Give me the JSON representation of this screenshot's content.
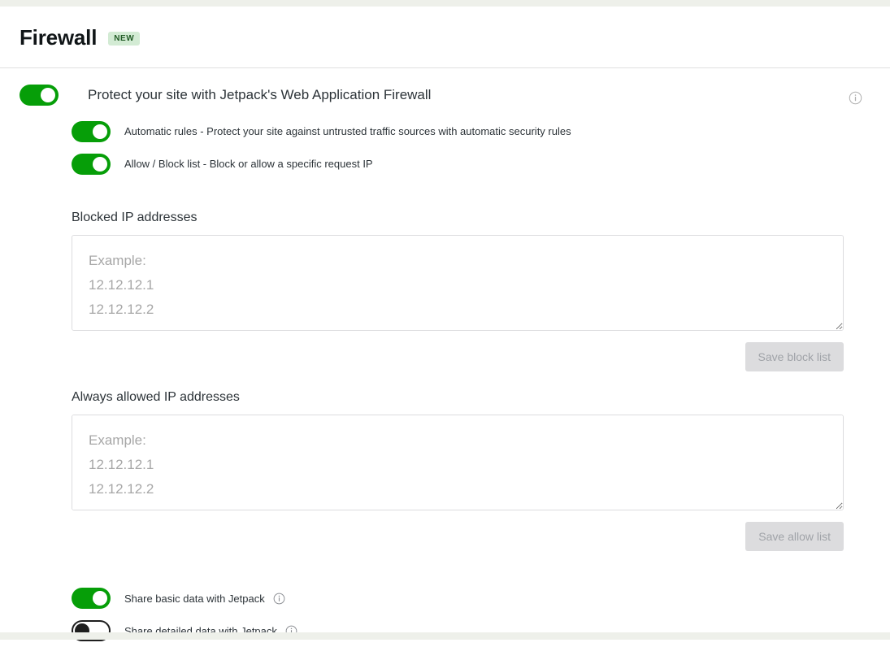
{
  "header": {
    "title": "Firewall",
    "badge": "NEW"
  },
  "master": {
    "label": "Protect your site with Jetpack's Web Application Firewall",
    "toggle_state": "on",
    "info_icon": "info-circle-icon"
  },
  "sub_toggles": [
    {
      "label": "Automatic rules - Protect your site against untrusted traffic sources with automatic security rules",
      "state": "on"
    },
    {
      "label": "Allow / Block list - Block or allow a specific request IP",
      "state": "on"
    }
  ],
  "blocked_section": {
    "label": "Blocked IP addresses",
    "value": "",
    "placeholder": "Example:\n12.12.12.1\n12.12.12.2",
    "save_label": "Save block list",
    "save_disabled": true
  },
  "allowed_section": {
    "label": "Always allowed IP addresses",
    "value": "",
    "placeholder": "Example:\n12.12.12.1\n12.12.12.2",
    "save_label": "Save allow list",
    "save_disabled": true
  },
  "share_toggles": [
    {
      "label": "Share basic data with Jetpack",
      "state": "on",
      "info_icon": "info-circle-icon"
    },
    {
      "label": "Share detailed data with Jetpack",
      "state": "off",
      "info_icon": "info-circle-icon"
    }
  ],
  "colors": {
    "toggle_on": "#069e08",
    "toggle_off_border": "#1e1e1e",
    "badge_bg": "#d3ebd4",
    "badge_text": "#225c26",
    "button_disabled_bg": "#dcdcde",
    "button_disabled_text": "#a0a3a8"
  }
}
